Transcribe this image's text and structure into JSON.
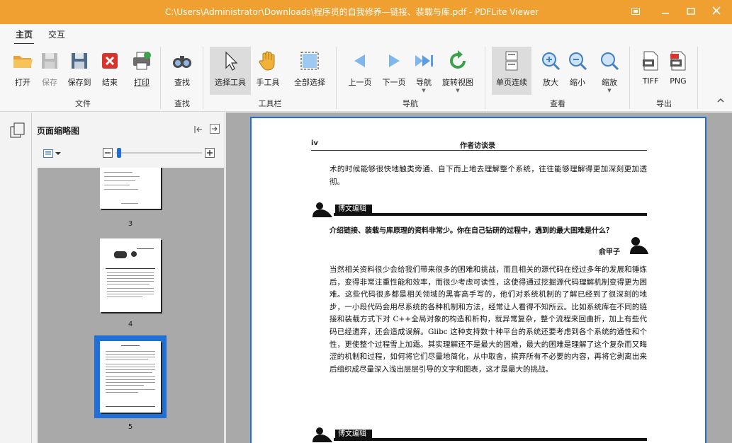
{
  "window": {
    "title": "C:\\Users\\Administrator\\Downloads\\程序员的自我修养—链接、装载与库.pdf - PDFLite Viewer"
  },
  "tabs": [
    "主页",
    "交互"
  ],
  "ribbon": {
    "buttons": {
      "open": "打开",
      "save": "保存",
      "save_to": "保存到",
      "close": "结束",
      "print": "打印",
      "find": "查找",
      "select_tool": "选择工具",
      "hand_tool": "手工具",
      "select_all": "全部选择",
      "prev_page": "上一页",
      "next_page": "下一页",
      "navigate": "导航",
      "rotate_view": "旋转视图",
      "single_continuous": "单页连续",
      "zoom_in": "放大",
      "zoom_out": "缩小",
      "zoom": "缩放",
      "tiff": "TIFF",
      "png": "PNG"
    },
    "groups": {
      "file": "文件",
      "find": "查找",
      "toolbar": "工具栏",
      "navigation": "导航",
      "view": "查看",
      "export": "导出"
    }
  },
  "sidebar": {
    "title": "页面缩略图",
    "thumbnails": [
      {
        "number": "3"
      },
      {
        "number": "4"
      },
      {
        "number": "5",
        "selected": true
      }
    ]
  },
  "page": {
    "number": "iv",
    "running_head": "作者访谈录",
    "para1": "术的时候能够很快地触类旁通、自下而上地去理解整个系统，往往能够理解得更加深刻更加透彻。",
    "section1_label": "博文编辑",
    "question": "介绍链接、装载与库原理的资料非常少。你在自己钻研的过程中，遇到的最大困难是什么？",
    "author": "俞甲子",
    "para2": "当然相关资料很少会给我们带来很多的困难和挑战，而且相关的源代码在经过多年的发展和锤炼后，变得非常注重性能和效率，而很少考虑可读性，这使得通过挖掘源代码理解机制变得更为困难。这些代码很多都是相关领域的黑客高手写的，他们对系统机制的了解已经到了很深刻的地步，一小段代码会用尽系统的各种机制和方法，经常让人看得不知所云。比如系统库在不同的链接和装载方式下对 C++全局对象的构造和析构，就异常复杂，整个流程来回曲折，加上有些代码已经遗弃，还会造成误解。Glibc 这种支持数十种平台的系统还要考虑到各个系统的通性和个性，更使整个过程雪上加霜。其实理解还不是最大的困难，最大的困难是理解了这个复杂而又晦涩的机制和过程，如何将它们尽量地简化，从中取舍，摈弃所有不必要的内容，再将它剥离出来后组织成尽量深入浅出层层引导的文字和图表，这才是最大的挑战。",
    "section2_label": "博文编辑"
  }
}
